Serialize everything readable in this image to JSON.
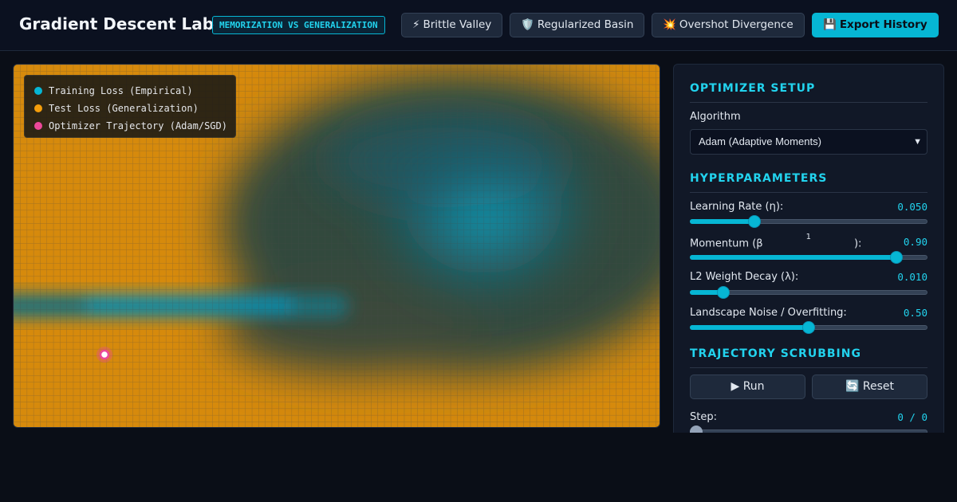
{
  "header": {
    "title": "Gradient Descent Lab",
    "badge": "MEMORIZATION VS GENERALIZATION",
    "buttons": [
      {
        "icon": "lightning-icon",
        "glyph": "⚡",
        "label": "Brittle Valley"
      },
      {
        "icon": "shield-icon",
        "glyph": "🛡️",
        "label": "Regularized Basin"
      },
      {
        "icon": "explosion-icon",
        "glyph": "💥",
        "label": "Overshot Divergence"
      },
      {
        "icon": "floppy-disk-icon",
        "glyph": "💾",
        "label": "Export History"
      }
    ]
  },
  "legend": [
    {
      "label": "Training Loss (Empirical)",
      "color": "#06b6d4"
    },
    {
      "label": "Test Loss (Generalization)",
      "color": "#f59e0b"
    },
    {
      "label": "Optimizer Trajectory (Adam/SGD)",
      "color": "#ec4899"
    }
  ],
  "colors": {
    "accent": "#06b6d4",
    "background": "#0a0e17",
    "panel": "#111827",
    "train": "#06b6d4",
    "test": "#f59e0b",
    "trajectory": "#ec4899"
  },
  "panel": {
    "optimizer_title": "OPTIMIZER SETUP",
    "algorithm_label": "Algorithm",
    "algorithm_value": "Adam (Adaptive Moments)",
    "hyper_title": "HYPERPARAMETERS",
    "learning_rate": {
      "label": "Learning Rate (η):",
      "value": "0.050",
      "fraction": 0.26
    },
    "momentum": {
      "label_pre": "Momentum (β",
      "label_sup": "1",
      "label_post": "):",
      "value": "0.90",
      "fraction": 0.89
    },
    "weight_decay": {
      "label": "L2 Weight Decay (λ):",
      "value": "0.010",
      "fraction": 0.12
    },
    "noise": {
      "label": "Landscape Noise / Overfitting:",
      "value": "0.50",
      "fraction": 0.5
    },
    "scrub_title": "TRAJECTORY SCRUBBING",
    "run_glyph": "▶",
    "run_label": "Run",
    "reset_glyph": "🔄",
    "reset_label": "Reset",
    "step_label": "Step:",
    "step_value": "0 / 0",
    "step_fraction": 0
  }
}
